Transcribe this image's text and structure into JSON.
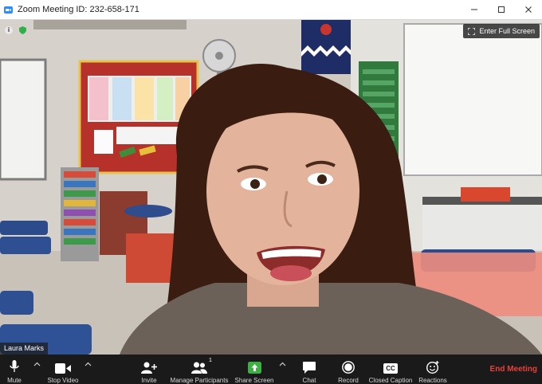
{
  "window": {
    "title": "Zoom Meeting ID: 232-658-171",
    "controls": [
      "minimize",
      "maximize",
      "close"
    ]
  },
  "video": {
    "fullscreen_label": "Enter Full Screen",
    "participant_name": "Laura Marks",
    "info_icon": "i"
  },
  "toolbar": {
    "mute": "Mute",
    "stop_video": "Stop Video",
    "invite": "Invite",
    "manage_participants": "Manage Participants",
    "participants_count": "1",
    "share_screen": "Share Screen",
    "chat": "Chat",
    "record": "Record",
    "closed_caption": "Closed Caption",
    "cc_icon_text": "CC",
    "reactions": "Reactions",
    "end_meeting": "End Meeting"
  },
  "colors": {
    "toolbar_bg": "#1a1a1a",
    "end_meeting": "#e8403a",
    "share_green": "#3cb043"
  }
}
